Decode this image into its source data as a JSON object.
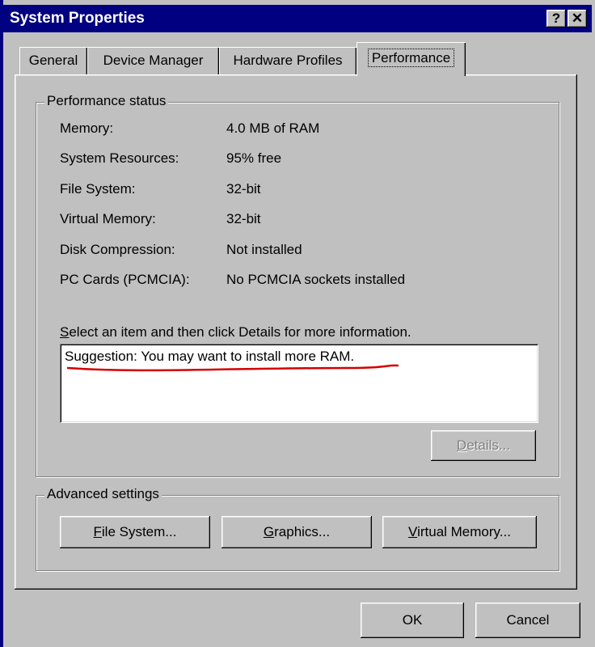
{
  "window": {
    "title": "System Properties"
  },
  "titlebar_buttons": {
    "help": "?",
    "close": "✕"
  },
  "tabs": [
    {
      "label": "General"
    },
    {
      "label": "Device Manager"
    },
    {
      "label": "Hardware Profiles"
    },
    {
      "label": "Performance",
      "selected": true
    }
  ],
  "performance_status": {
    "legend": "Performance status",
    "rows": [
      {
        "label": "Memory:",
        "value": "4.0 MB of RAM"
      },
      {
        "label": "System Resources:",
        "value": "95% free"
      },
      {
        "label": "File System:",
        "value": "32-bit"
      },
      {
        "label": "Virtual Memory:",
        "value": "32-bit"
      },
      {
        "label": "Disk Compression:",
        "value": "Not installed"
      },
      {
        "label": "PC Cards (PCMCIA):",
        "value": "No PCMCIA sockets installed"
      }
    ],
    "instruction_mnemonic": "S",
    "instruction_rest": "elect an item and then click Details for more information.",
    "suggestions": [
      "Suggestion: You may want to install more RAM."
    ],
    "details_mnemonic": "D",
    "details_rest": "etails..."
  },
  "advanced_settings": {
    "legend": "Advanced settings",
    "file_system": {
      "mnemonic": "F",
      "rest": "ile System..."
    },
    "graphics": {
      "mnemonic": "G",
      "rest": "raphics..."
    },
    "virtual_memory": {
      "mnemonic": "V",
      "rest": "irtual Memory..."
    }
  },
  "footer": {
    "ok": "OK",
    "cancel": "Cancel"
  },
  "colors": {
    "titlebar": "#000080",
    "face": "#c0c0c0",
    "annotation_underline": "#d40000"
  }
}
